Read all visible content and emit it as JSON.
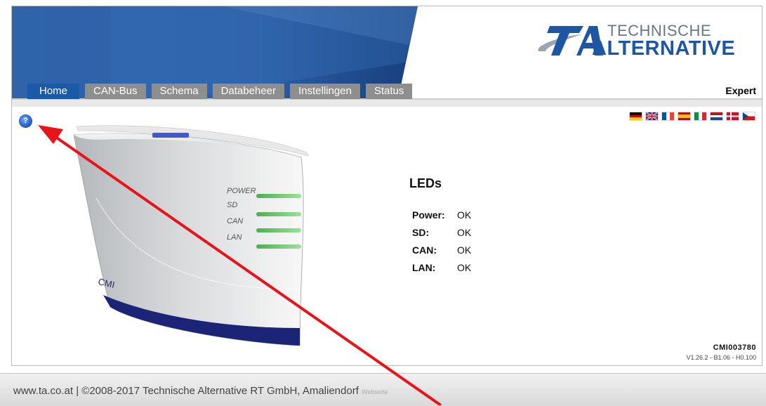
{
  "brand": {
    "line1": "TECHNISCHE",
    "line2": "ALTERNATIVE",
    "mark": "TA",
    "primary_color": "#1a5aa7"
  },
  "nav": {
    "tabs": [
      {
        "label": "Home",
        "active": true
      },
      {
        "label": "CAN-Bus",
        "active": false
      },
      {
        "label": "Schema",
        "active": false
      },
      {
        "label": "Databeheer",
        "active": false
      },
      {
        "label": "Instellingen",
        "active": false
      },
      {
        "label": "Status",
        "active": false
      }
    ],
    "mode_label": "Expert"
  },
  "help": {
    "icon": "help-icon",
    "glyph": "?"
  },
  "languages": [
    {
      "code": "de",
      "icon": "flag-germany-icon"
    },
    {
      "code": "en",
      "icon": "flag-uk-icon"
    },
    {
      "code": "fr",
      "icon": "flag-france-icon"
    },
    {
      "code": "es",
      "icon": "flag-spain-icon"
    },
    {
      "code": "it",
      "icon": "flag-italy-icon"
    },
    {
      "code": "nl",
      "icon": "flag-netherlands-icon"
    },
    {
      "code": "dk",
      "icon": "flag-denmark-icon"
    },
    {
      "code": "cz",
      "icon": "flag-czech-icon"
    }
  ],
  "device": {
    "led_labels": [
      "POWER",
      "SD",
      "CAN",
      "LAN"
    ],
    "badge": "CMI"
  },
  "leds": {
    "title": "LEDs",
    "rows": [
      {
        "label": "Power:",
        "value": "OK"
      },
      {
        "label": "SD:",
        "value": "OK"
      },
      {
        "label": "CAN:",
        "value": "OK"
      },
      {
        "label": "LAN:",
        "value": "OK"
      }
    ]
  },
  "device_info": {
    "serial": "CMI003780",
    "version": "V1.26.2 - B1.06 - H0.100"
  },
  "footer": {
    "text": "www.ta.co.at | ©2008-2017 Technische Alternative RT GmbH, Amaliendorf",
    "ghost": "Webseite"
  }
}
